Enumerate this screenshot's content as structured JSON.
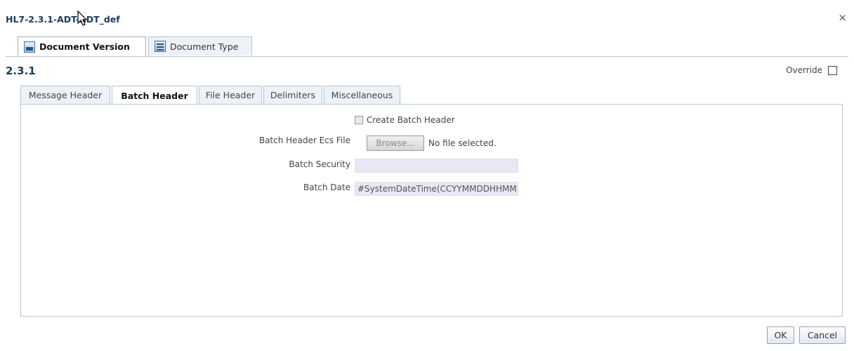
{
  "dialog": {
    "title": "HL7-2.3.1-ADT-ADT_def",
    "close_symbol": "×"
  },
  "top_tabs": [
    {
      "label": "Document Version",
      "icon": "document-version-icon",
      "active": true
    },
    {
      "label": "Document Type",
      "icon": "document-type-icon",
      "active": false
    }
  ],
  "version": "2.3.1",
  "override": {
    "label": "Override",
    "checked": false
  },
  "inner_tabs": [
    {
      "label": "Message Header",
      "active": false
    },
    {
      "label": "Batch Header",
      "active": true
    },
    {
      "label": "File Header",
      "active": false
    },
    {
      "label": "Delimiters",
      "active": false
    },
    {
      "label": "Miscellaneous",
      "active": false
    }
  ],
  "form": {
    "create_batch_header": {
      "label": "Create Batch Header",
      "checked": false,
      "disabled": true
    },
    "ecs_file": {
      "label": "Batch Header Ecs File",
      "button": "Browse...",
      "status": "No file selected."
    },
    "security": {
      "label": "Batch Security",
      "value": ""
    },
    "date": {
      "label": "Batch Date",
      "value": "#SystemDateTime(CCYYMMDDHHMM"
    }
  },
  "buttons": {
    "ok": "OK",
    "cancel": "Cancel"
  }
}
